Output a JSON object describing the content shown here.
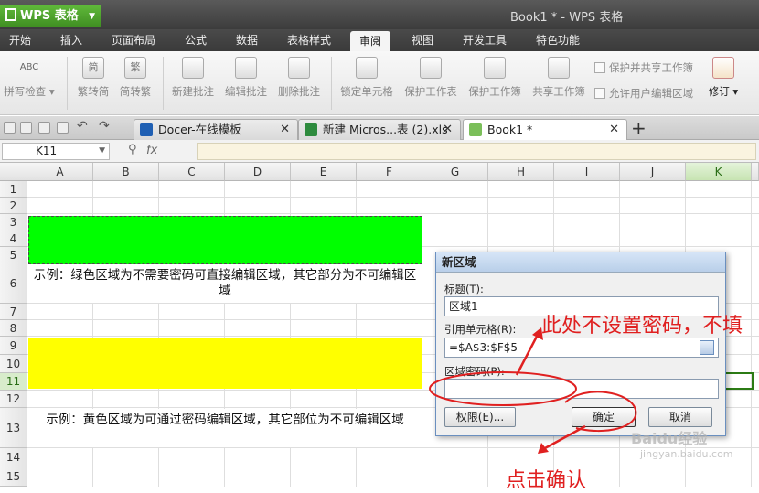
{
  "app": {
    "name": "WPS 表格",
    "window_title": "Book1 * - WPS 表格"
  },
  "menu": [
    "开始",
    "插入",
    "页面布局",
    "公式",
    "数据",
    "表格样式",
    "审阅",
    "视图",
    "开发工具",
    "特色功能"
  ],
  "menu_active_index": 6,
  "ribbon": {
    "spell": "拼写检查",
    "to_simplified": "繁转简",
    "to_traditional": "简转繁",
    "new_comment": "新建批注",
    "edit_comment": "编辑批注",
    "delete_comment": "删除批注",
    "lock_cells": "锁定单元格",
    "protect_sheet": "保护工作表",
    "protect_book": "保护工作簿",
    "share_book": "共享工作簿",
    "protect_share": "保护并共享工作簿",
    "allow_edit_ranges": "允许用户编辑区域",
    "track_changes": "修订",
    "simplified_glyph": "简",
    "traditional_glyph": "繁",
    "abc": "ABC"
  },
  "doc_tabs": [
    {
      "label": "Docer-在线模板",
      "icon": "docer-icon"
    },
    {
      "label": "新建 Micros...表 (2).xls",
      "icon": "excel-icon"
    },
    {
      "label": "Book1 *",
      "icon": "sheet-icon"
    }
  ],
  "formula_bar": {
    "name_box": "K11",
    "fx": "fx",
    "value": ""
  },
  "columns": [
    "A",
    "B",
    "C",
    "D",
    "E",
    "F",
    "G",
    "H",
    "I",
    "J",
    "K"
  ],
  "rows": [
    "1",
    "2",
    "3",
    "4",
    "5",
    "6",
    "7",
    "8",
    "9",
    "10",
    "11",
    "12",
    "13",
    "14",
    "15"
  ],
  "cells": {
    "note_green": "示例：绿色区域为不需要密码可直接编辑区域，其它部分为不可编辑区域",
    "note_yellow": "示例：黄色区域为可通过密码编辑区域，其它部位为不可编辑区域"
  },
  "colors": {
    "green_area": "#00ff00",
    "yellow_area": "#ffff00",
    "app_green": "#4a9e2a",
    "annotation_red": "#e02020"
  },
  "dialog": {
    "title": "新区域",
    "title_label": "标题(T):",
    "title_value": "区域1",
    "ref_label": "引用单元格(R):",
    "ref_value": "=$A$3:$F$5",
    "pwd_label": "区域密码(P):",
    "pwd_value": "",
    "perm_button": "权限(E)...",
    "ok_button": "确定",
    "cancel_button": "取消"
  },
  "annotations": {
    "no_password": "此处不设置密码，不填",
    "click_ok": "点击确认"
  },
  "watermark": {
    "line1": "Baidu经验",
    "line2": "jingyan.baidu.com"
  }
}
